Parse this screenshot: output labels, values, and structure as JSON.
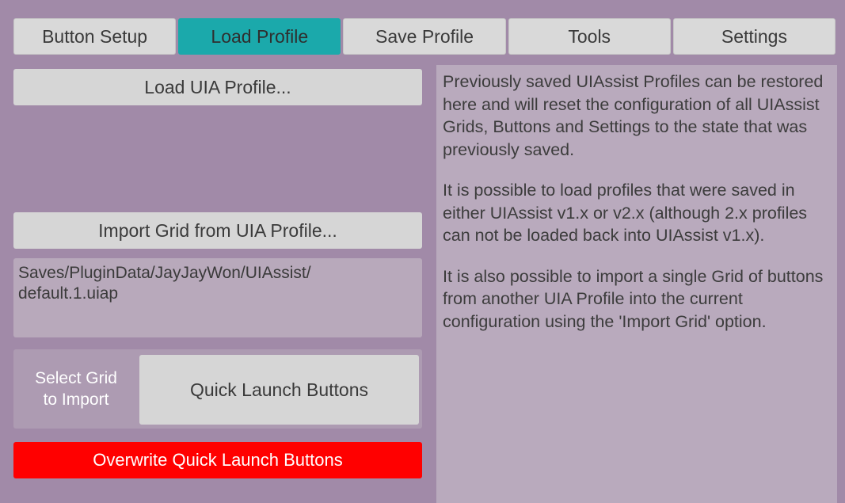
{
  "tabs": [
    {
      "label": "Button Setup",
      "active": false
    },
    {
      "label": "Load Profile",
      "active": true
    },
    {
      "label": "Save Profile",
      "active": false
    },
    {
      "label": "Tools",
      "active": false
    },
    {
      "label": "Settings",
      "active": false
    }
  ],
  "load_button_label": "Load UIA Profile...",
  "import_button_label": "Import Grid from UIA Profile...",
  "path": {
    "line1": "Saves/PluginData/JayJayWon/UIAssist/",
    "line2": "default.1.uiap"
  },
  "select_grid": {
    "label_line1": "Select Grid",
    "label_line2": "to Import",
    "value": "Quick Launch Buttons"
  },
  "overwrite_button_label": "Overwrite Quick Launch Buttons",
  "info": {
    "p1": "Previously saved UIAssist Profiles can be restored here and will reset the configuration of all UIAssist Grids, Buttons and Settings to the state that was previously saved.",
    "p2": "It is possible to load profiles that were saved in either UIAssist v1.x or v2.x (although 2.x profiles can not be loaded back into UIAssist v1.x).",
    "p3": "It is also possible to import a single Grid of buttons from another UIA Profile into the current configuration using the 'Import Grid' option."
  },
  "colors": {
    "background": "#a18aa8",
    "active_tab": "#1ba9ab",
    "overwrite_button": "#ff0000",
    "info_panel": "#b9aabd"
  }
}
